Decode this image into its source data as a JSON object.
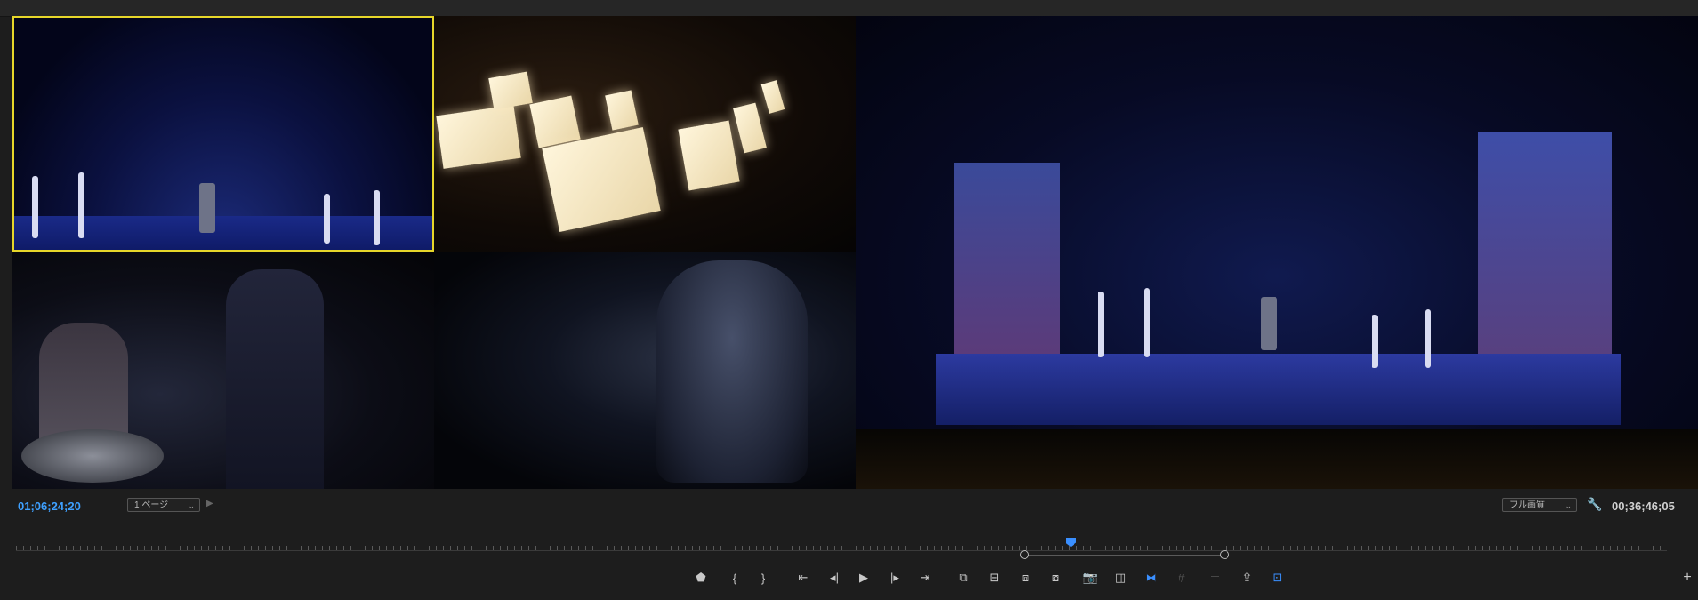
{
  "viewer": {
    "cameras": [
      {
        "id": 1,
        "scene": "stage-wide-dancers",
        "active": true
      },
      {
        "id": 2,
        "scene": "orchestra-music-stands",
        "active": false
      },
      {
        "id": 3,
        "scene": "dancer-closeup",
        "active": false
      },
      {
        "id": 4,
        "scene": "costumed-figure",
        "active": false
      },
      {
        "id": 5,
        "scene": "stage-full-view",
        "active": false
      }
    ],
    "active_border_color": "#e6d62a"
  },
  "status": {
    "timecode_left": "01;06;24;20",
    "page_select": "1 ページ",
    "quality_select": "フル画質",
    "timecode_right": "00;36;46;05"
  },
  "timeline": {
    "playhead_color": "#3a8fff"
  },
  "transport": {
    "buttons": [
      {
        "name": "add-marker-button",
        "glyph": "⬟",
        "state": "normal"
      },
      {
        "name": "mark-in-button",
        "glyph": "{",
        "state": "normal"
      },
      {
        "name": "mark-out-button",
        "glyph": "}",
        "state": "normal"
      },
      {
        "name": "go-to-in-button",
        "glyph": "⇤",
        "state": "normal"
      },
      {
        "name": "step-back-button",
        "glyph": "◂|",
        "state": "normal"
      },
      {
        "name": "play-button",
        "glyph": "▶",
        "state": "normal"
      },
      {
        "name": "step-forward-button",
        "glyph": "|▸",
        "state": "normal"
      },
      {
        "name": "go-to-out-button",
        "glyph": "⇥",
        "state": "normal"
      },
      {
        "name": "insert-button",
        "glyph": "⧉",
        "state": "normal"
      },
      {
        "name": "overwrite-button",
        "glyph": "⊟",
        "state": "normal"
      },
      {
        "name": "lift-button",
        "glyph": "⧈",
        "state": "normal"
      },
      {
        "name": "extract-button",
        "glyph": "⧇",
        "state": "normal"
      },
      {
        "name": "export-frame-button",
        "glyph": "📷",
        "state": "normal"
      },
      {
        "name": "comparison-view-button",
        "glyph": "◫",
        "state": "normal"
      },
      {
        "name": "multicam-toggle-button",
        "glyph": "⧓",
        "state": "on"
      },
      {
        "name": "grid-button",
        "glyph": "#",
        "state": "dim"
      },
      {
        "name": "safe-margins-button",
        "glyph": "▭",
        "state": "dim"
      },
      {
        "name": "export-button",
        "glyph": "⇪",
        "state": "normal"
      },
      {
        "name": "vr-view-button",
        "glyph": "⊡",
        "state": "on"
      }
    ],
    "add_button": "+"
  }
}
